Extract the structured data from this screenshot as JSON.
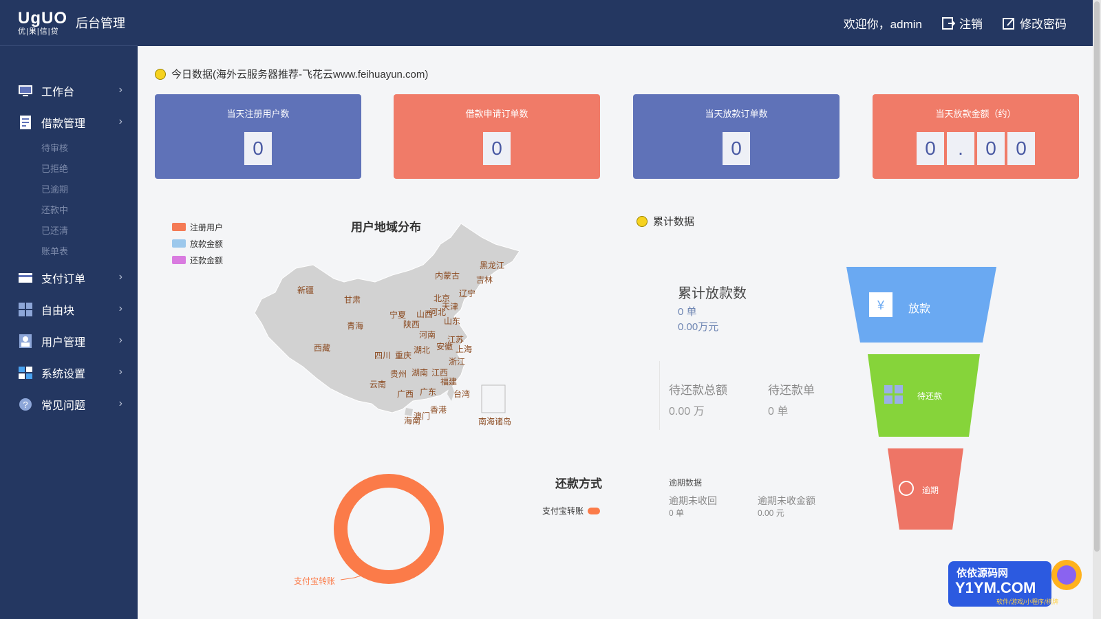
{
  "logo": {
    "main": "UgUO",
    "sub": "优|果|信|贷",
    "title": "后台管理"
  },
  "topbar": {
    "welcome": "欢迎你，admin",
    "logout": "注销",
    "change_password": "修改密码"
  },
  "sidebar": {
    "items": [
      {
        "label": "工作台",
        "icon": "monitor-icon"
      },
      {
        "label": "借款管理",
        "icon": "document-icon"
      },
      {
        "label": "支付订单",
        "icon": "card-icon"
      },
      {
        "label": "自由块",
        "icon": "grid-icon"
      },
      {
        "label": "用户管理",
        "icon": "user-icon"
      },
      {
        "label": "系统设置",
        "icon": "windows-icon"
      },
      {
        "label": "常见问题",
        "icon": "question-icon"
      }
    ],
    "loan_subitems": [
      "待审核",
      "已拒绝",
      "已逾期",
      "还款中",
      "已还清",
      "账单表"
    ]
  },
  "today": {
    "title": "今日数据(海外云服务器推荐-飞花云www.feihuayun.com)",
    "cards": [
      {
        "label": "当天注册用户数",
        "digits": [
          "0"
        ]
      },
      {
        "label": "借款申请订单数",
        "digits": [
          "0"
        ]
      },
      {
        "label": "当天放款订单数",
        "digits": [
          "0"
        ]
      },
      {
        "label": "当天放款金额（约）",
        "digits": [
          "0",
          ".",
          "0",
          "0"
        ]
      }
    ]
  },
  "map": {
    "title": "用户地域分布",
    "legend": [
      "注册用户",
      "放款金额",
      "还款金额"
    ],
    "provinces": [
      "黑龙江",
      "吉林",
      "辽宁",
      "内蒙古",
      "北京",
      "天津",
      "河北",
      "山西",
      "山东",
      "宁夏",
      "陕西",
      "甘肃",
      "新疆",
      "青海",
      "西藏",
      "四川",
      "重庆",
      "河南",
      "江苏",
      "安徽",
      "上海",
      "湖北",
      "浙江",
      "贵州",
      "湖南",
      "江西",
      "福建",
      "云南",
      "广西",
      "广东",
      "台湾",
      "香港",
      "澳门",
      "海南",
      "南海诸岛"
    ]
  },
  "cumulative": {
    "title": "累计数据",
    "total_loans_label": "累计放款数",
    "total_loans_count": "0 单",
    "total_loans_amount": "0.00万元",
    "pending_total_label": "待还款总额",
    "pending_total_value": "0.00 万",
    "pending_orders_label": "待还款单",
    "pending_orders_value": "0 单",
    "funnel": [
      "放款",
      "待还款",
      "逾期"
    ]
  },
  "overdue": {
    "title": "逾期数据",
    "unrecovered_label": "逾期未收回",
    "unrecovered_value": "0 单",
    "uncollected_label": "逾期未收金额",
    "uncollected_value": "0.00 元"
  },
  "repay_method": {
    "title": "还款方式",
    "legend": "支付宝转账",
    "slice_label": "支付宝转账"
  },
  "chart_data": {
    "type": "pie",
    "title": "还款方式",
    "categories": [
      "支付宝转账"
    ],
    "values": [
      0
    ]
  },
  "watermark": {
    "line1": "依依源码网",
    "line2": "Y1YM.COM",
    "line3": "软件/游戏/小程序/棋牌"
  },
  "colors": {
    "sidebar": "#243761",
    "card_blue": "#5f72b8",
    "card_red": "#f07b68",
    "funnel_blue": "#6aa9f2",
    "funnel_green": "#86d43a",
    "funnel_red": "#ee7566",
    "ring": "#fb7b49"
  }
}
